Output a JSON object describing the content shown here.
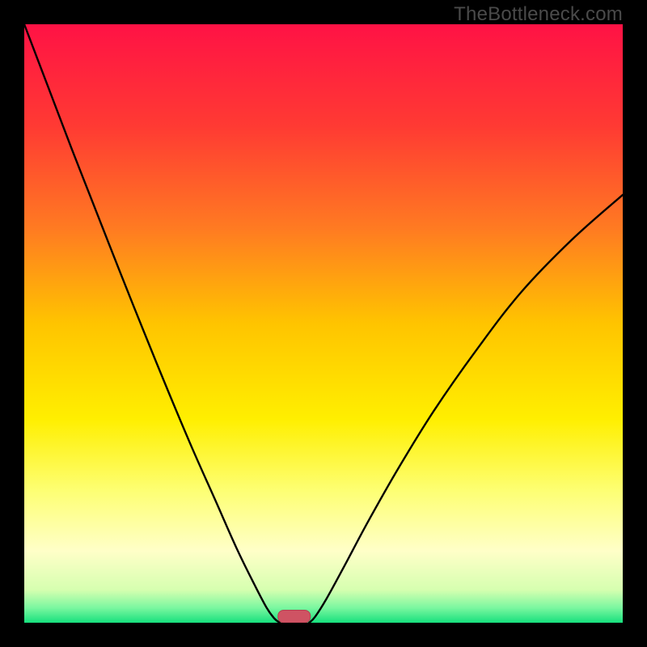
{
  "watermark": "TheBottleneck.com",
  "chart_data": {
    "type": "line",
    "title": "",
    "xlabel": "",
    "ylabel": "",
    "xlim": [
      0,
      1
    ],
    "ylim": [
      0,
      1
    ],
    "background_gradient_stops": [
      {
        "offset": 0.0,
        "color": "#ff1245"
      },
      {
        "offset": 0.17,
        "color": "#ff3a33"
      },
      {
        "offset": 0.34,
        "color": "#ff7a22"
      },
      {
        "offset": 0.5,
        "color": "#ffc400"
      },
      {
        "offset": 0.66,
        "color": "#ffef00"
      },
      {
        "offset": 0.78,
        "color": "#fdff74"
      },
      {
        "offset": 0.88,
        "color": "#ffffc8"
      },
      {
        "offset": 0.945,
        "color": "#d6ffb0"
      },
      {
        "offset": 0.975,
        "color": "#7bf7a0"
      },
      {
        "offset": 1.0,
        "color": "#17e07d"
      }
    ],
    "series": [
      {
        "name": "left-curve",
        "x": [
          0.0,
          0.04,
          0.08,
          0.12,
          0.16,
          0.2,
          0.24,
          0.28,
          0.32,
          0.355,
          0.385,
          0.405,
          0.418,
          0.427
        ],
        "y": [
          1.0,
          0.895,
          0.79,
          0.688,
          0.586,
          0.486,
          0.388,
          0.293,
          0.203,
          0.124,
          0.063,
          0.025,
          0.007,
          0.0
        ]
      },
      {
        "name": "right-curve",
        "x": [
          0.476,
          0.486,
          0.505,
          0.535,
          0.575,
          0.625,
          0.685,
          0.755,
          0.83,
          0.915,
          1.0
        ],
        "y": [
          0.0,
          0.01,
          0.04,
          0.095,
          0.17,
          0.258,
          0.355,
          0.455,
          0.552,
          0.64,
          0.715
        ]
      }
    ],
    "marker": {
      "name": "bottleneck-marker",
      "x_center": 0.451,
      "width": 0.054,
      "height": 0.021,
      "fill": "#cf5363",
      "stroke": "#b73f50"
    }
  }
}
